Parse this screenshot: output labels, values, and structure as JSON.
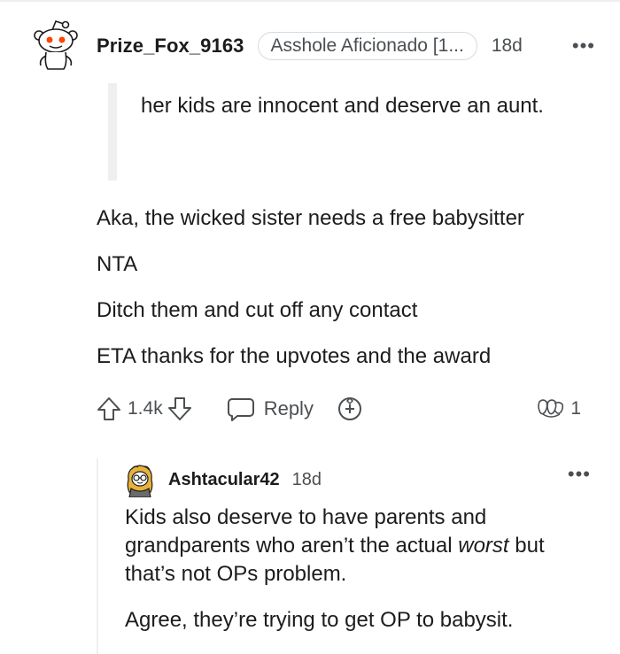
{
  "comment": {
    "username": "Prize_Fox_9163",
    "flair": "Asshole Aficionado [1...",
    "timestamp": "18d",
    "more": "•••",
    "quote": "her kids are innocent and deserve an aunt.",
    "paragraphs": [
      "Aka, the wicked sister needs a free babysitter",
      "NTA",
      "Ditch them and cut off any contact",
      "ETA thanks for the upvotes and the award"
    ],
    "actions": {
      "vote_count": "1.4k",
      "reply_label": "Reply",
      "award_count": "1"
    }
  },
  "reply": {
    "username": "Ashtacular42",
    "timestamp": "18d",
    "more": "•••",
    "p1_before": "Kids also deserve to have parents and grandparents who aren’t the actual ",
    "p1_emphasis": "worst",
    "p1_after": " but that’s not OPs problem.",
    "p2": "Agree, they’re trying to get OP to babysit."
  },
  "colors": {
    "text": "#1c1c1c",
    "meta": "#4b4f52",
    "border": "#d7dadc",
    "quote_bar": "#edeff1",
    "avatar_accent": "#ff4500"
  },
  "icons": [
    "snoo-avatar-icon",
    "upvote-icon",
    "downvote-icon",
    "comment-bubble-icon",
    "award-plus-icon",
    "award-icon",
    "ashtacular-avatar-icon"
  ]
}
